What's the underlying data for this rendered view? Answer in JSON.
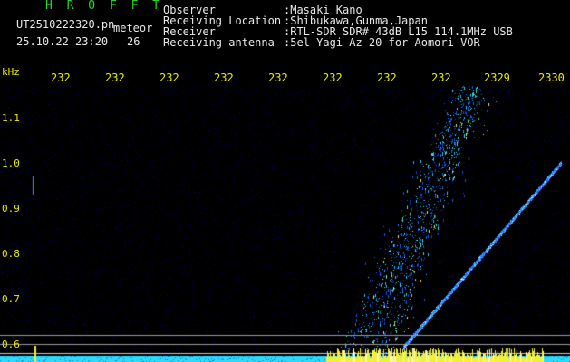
{
  "header": {
    "title": "H R O F F T",
    "filename": "UT2510222320.pn",
    "tag": "meteor",
    "datetime": "25.10.22 23:20",
    "count": "26"
  },
  "info": {
    "labels": [
      "Observer",
      "Receiving Location",
      "Receiver",
      "Receiving antenna"
    ],
    "values": [
      ":Masaki Kano",
      ":Shibukawa,Gunma,Japan",
      ":RTL-SDR SDR# 43dB L15 114.1MHz USB",
      ":5el Yagi Az 20 for Aomori VOR"
    ]
  },
  "axis": {
    "unit": "kHz",
    "y_labels": [
      "1.1",
      "1.0",
      "0.9",
      "0.8",
      "0.7",
      "0.6"
    ],
    "time_labels": [
      "232",
      "232",
      "232",
      "232",
      "232",
      "232",
      "232",
      "232",
      "2329",
      "2330"
    ]
  },
  "colors": {
    "header_green": "#26d426",
    "text_white": "#e8e8e8",
    "tick_yellow": "#e8e800",
    "signal_blue": "#2a6cff",
    "signal_cyan": "#30e8ff",
    "baseline_yellow": "#f0f040"
  }
}
